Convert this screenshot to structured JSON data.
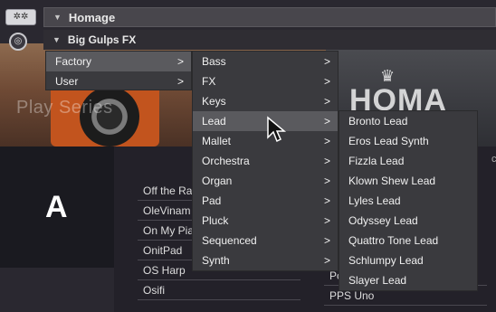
{
  "header": {
    "title": "Homage",
    "subtitle": "Big Gulps FX"
  },
  "background": {
    "play_series": "Play Series",
    "logo_text": "HOMA",
    "section_letter": "A",
    "edge_text": "c",
    "list": [
      "Off the Ra",
      "OleVinam",
      "On My Pia",
      "OnitPad",
      "OS Harp",
      "Osifi"
    ],
    "list2": [
      "Pc",
      "PPS Uno"
    ]
  },
  "menu_level1": {
    "items": [
      {
        "label": "Factory",
        "arrow": ">"
      },
      {
        "label": "User",
        "arrow": ">"
      }
    ]
  },
  "menu_level2": {
    "items": [
      {
        "label": "Bass",
        "arrow": ">"
      },
      {
        "label": "FX",
        "arrow": ">"
      },
      {
        "label": "Keys",
        "arrow": ">"
      },
      {
        "label": "Lead",
        "arrow": ">"
      },
      {
        "label": "Mallet",
        "arrow": ">"
      },
      {
        "label": "Orchestra",
        "arrow": ">"
      },
      {
        "label": "Organ",
        "arrow": ">"
      },
      {
        "label": "Pad",
        "arrow": ">"
      },
      {
        "label": "Pluck",
        "arrow": ">"
      },
      {
        "label": "Sequenced",
        "arrow": ">"
      },
      {
        "label": "Synth",
        "arrow": ">"
      }
    ]
  },
  "menu_level3": {
    "items": [
      {
        "label": "Bronto Lead"
      },
      {
        "label": "Eros Lead Synth"
      },
      {
        "label": "Fizzla Lead"
      },
      {
        "label": "Klown Shew Lead"
      },
      {
        "label": "Lyles Lead"
      },
      {
        "label": "Odyssey Lead"
      },
      {
        "label": "Quattro Tone Lead"
      },
      {
        "label": "Schlumpy Lead"
      },
      {
        "label": "Slayer Lead"
      }
    ]
  },
  "icons": {
    "gear": "gear-icon",
    "settings": "settings-circle-icon",
    "collapse": "triangle-down-icon",
    "submenu": "chevron-right-icon",
    "cursor": "mouse-pointer-icon"
  },
  "colors": {
    "menu_bg": "#3a3a3e",
    "menu_highlight": "#5a5a5e",
    "speaker_orange": "#c2541e"
  }
}
